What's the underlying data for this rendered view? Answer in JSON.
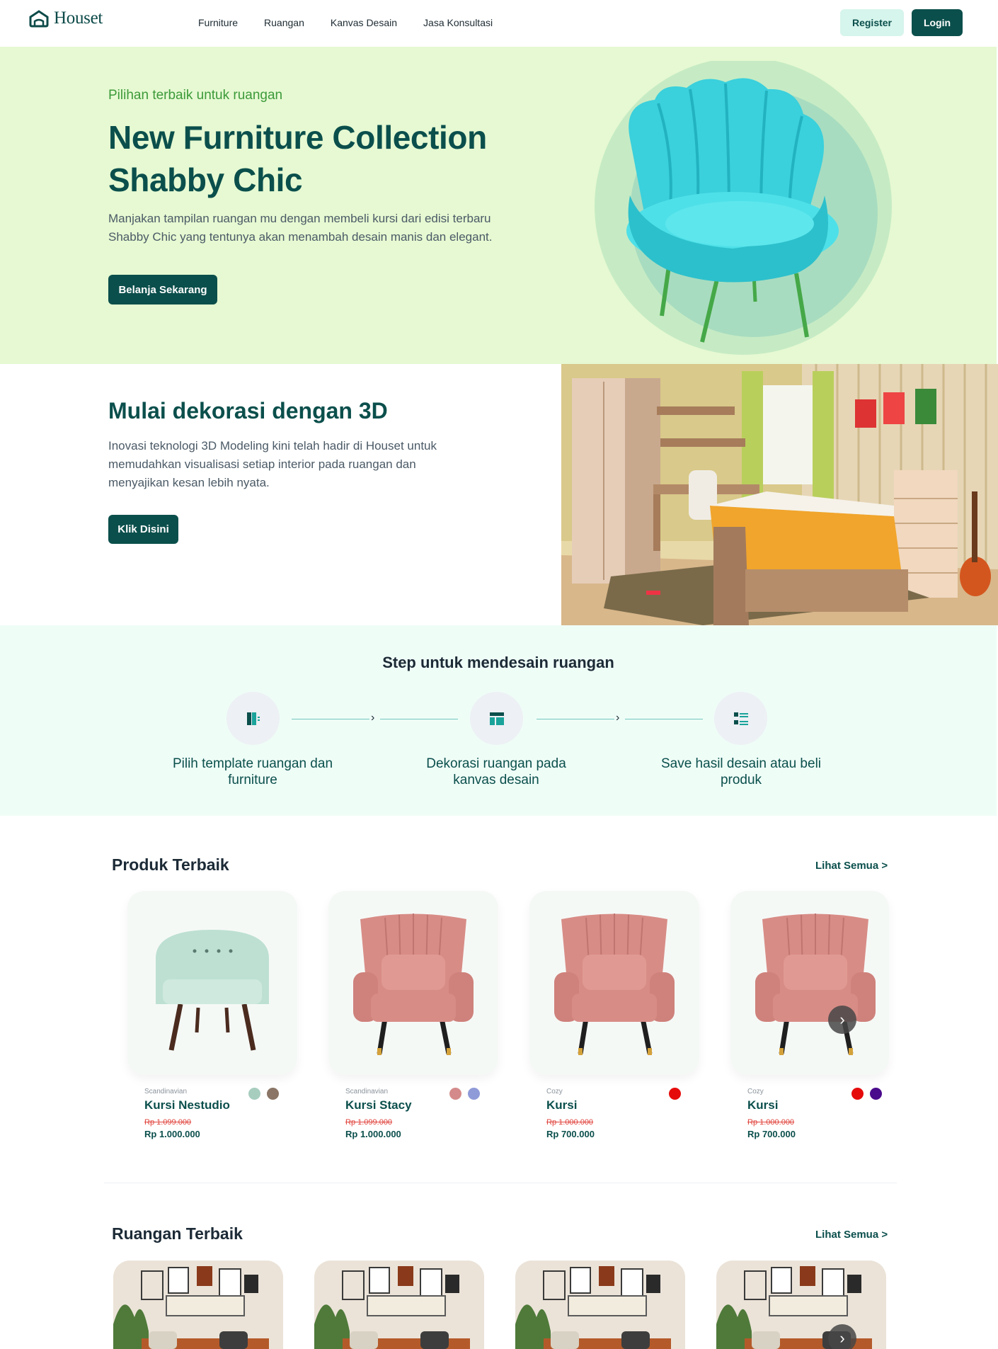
{
  "brand": {
    "name": "Houset"
  },
  "nav": {
    "items": [
      "Furniture",
      "Ruangan",
      "Kanvas Desain",
      "Jasa Konsultasi"
    ],
    "register_label": "Register",
    "login_label": "Login"
  },
  "hero": {
    "kicker": "Pilihan terbaik untuk ruangan",
    "title": "New Furniture Collection Shabby Chic",
    "description": "Manjakan tampilan ruangan mu dengan membeli kursi dari edisi terbaru Shabby Chic yang tentunya akan menambah desain manis dan elegant.",
    "cta_label": "Belanja Sekarang"
  },
  "decor3d": {
    "title": "Mulai dekorasi dengan 3D",
    "description": "Inovasi teknologi 3D Modeling kini telah hadir di Houset untuk memudahkan visualisasi setiap interior pada ruangan dan menyajikan kesan lebih nyata.",
    "cta_label": "Klik Disini"
  },
  "steps": {
    "title": "Step untuk mendesain ruangan",
    "items": [
      {
        "label": "Pilih template ruangan dan furniture",
        "icon": "template-icon"
      },
      {
        "label": "Dekorasi ruangan pada kanvas desain",
        "icon": "layout-icon"
      },
      {
        "label": "Save hasil desain atau beli produk",
        "icon": "list-icon"
      }
    ]
  },
  "products": {
    "title": "Produk Terbaik",
    "see_all": "Lihat Semua >",
    "items": [
      {
        "category": "Scandinavian",
        "name": "Kursi Nestudio",
        "old_price": "Rp 1.099.000",
        "price": "Rp 1.000.000",
        "colors": [
          "#a7cdbf",
          "#8a7566"
        ],
        "chair_color": "#bde0d3"
      },
      {
        "category": "Scandinavian",
        "name": "Kursi Stacy",
        "old_price": "Rp 1.099.000",
        "price": "Rp 1.000.000",
        "colors": [
          "#d48a8a",
          "#8f9ad8"
        ],
        "chair_color": "#d88c86"
      },
      {
        "category": "Cozy",
        "name": "Kursi",
        "old_price": "Rp 1.000.000",
        "price": "Rp 700.000",
        "colors": [
          "#e60b0b"
        ],
        "chair_color": "#d88c86"
      },
      {
        "category": "Cozy",
        "name": "Kursi",
        "old_price": "Rp 1.000.000",
        "price": "Rp 700.000",
        "colors": [
          "#e60b0b",
          "#4a0a8c"
        ],
        "chair_color": "#d88c86"
      }
    ]
  },
  "rooms": {
    "title": "Ruangan Terbaik",
    "see_all": "Lihat Semua >"
  },
  "colors": {
    "primary": "#0b4f4c",
    "hero_bg": "#e6f9d2",
    "steps_bg": "#effdf7",
    "accent_green": "#3c9a3a"
  }
}
